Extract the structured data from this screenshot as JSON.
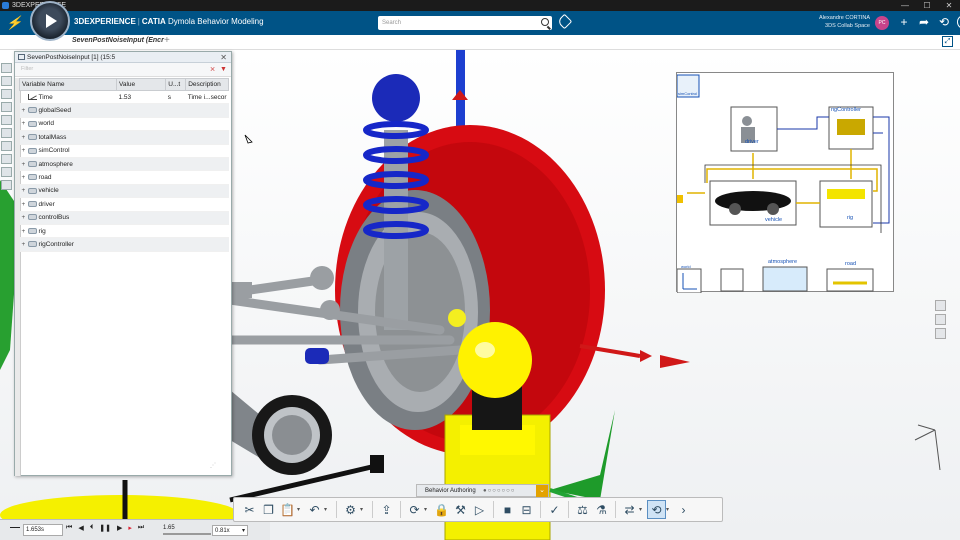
{
  "window": {
    "title": "3DEXPERIENCE",
    "controls": [
      "—",
      "☐",
      "✕"
    ]
  },
  "topbar": {
    "brand_platform": "3DEXPERIENCE",
    "brand_app": "CATIA",
    "brand_module": "Dymola Behavior Modeling",
    "search_placeholder": "Search",
    "user_name": "Alexandre CORTINA",
    "user_space": "3DS Collab Space",
    "avatar_initials": "PC",
    "accent_color": "#005386"
  },
  "tabs": {
    "active": "SevenPostNoiseInput (Encr",
    "add": "+"
  },
  "variable_panel": {
    "title": "SevenPostNoiseInput [1] (15:5",
    "filter_placeholder": "Filter",
    "columns": [
      "Variable Name",
      "Value",
      "U...t",
      "Description"
    ],
    "rows": [
      {
        "name": "Time",
        "value": "1.53",
        "unit": "s",
        "desc": "Time i...secor"
      },
      {
        "name": "globalSeed",
        "value": "",
        "unit": "",
        "desc": ""
      },
      {
        "name": "world",
        "value": "",
        "unit": "",
        "desc": ""
      },
      {
        "name": "totalMass",
        "value": "",
        "unit": "",
        "desc": ""
      },
      {
        "name": "simControl",
        "value": "",
        "unit": "",
        "desc": ""
      },
      {
        "name": "atmosphere",
        "value": "",
        "unit": "",
        "desc": ""
      },
      {
        "name": "road",
        "value": "",
        "unit": "",
        "desc": ""
      },
      {
        "name": "vehicle",
        "value": "",
        "unit": "",
        "desc": ""
      },
      {
        "name": "driver",
        "value": "",
        "unit": "",
        "desc": ""
      },
      {
        "name": "controlBus",
        "value": "",
        "unit": "",
        "desc": ""
      },
      {
        "name": "rig",
        "value": "",
        "unit": "",
        "desc": ""
      },
      {
        "name": "rigController",
        "value": "",
        "unit": "",
        "desc": ""
      }
    ]
  },
  "diagram": {
    "blocks": {
      "driver": "driver",
      "rigController": "rigController",
      "vehicle": "vehicle",
      "rig": "rig",
      "atmosphere": "atmosphere",
      "road": "road",
      "world": "world",
      "simControl": "simControl"
    }
  },
  "timeline": {
    "time_value": "1.653s",
    "slider_value": "1.65",
    "speed": "0.81x"
  },
  "action_bar": {
    "label": "Behavior Authoring"
  }
}
